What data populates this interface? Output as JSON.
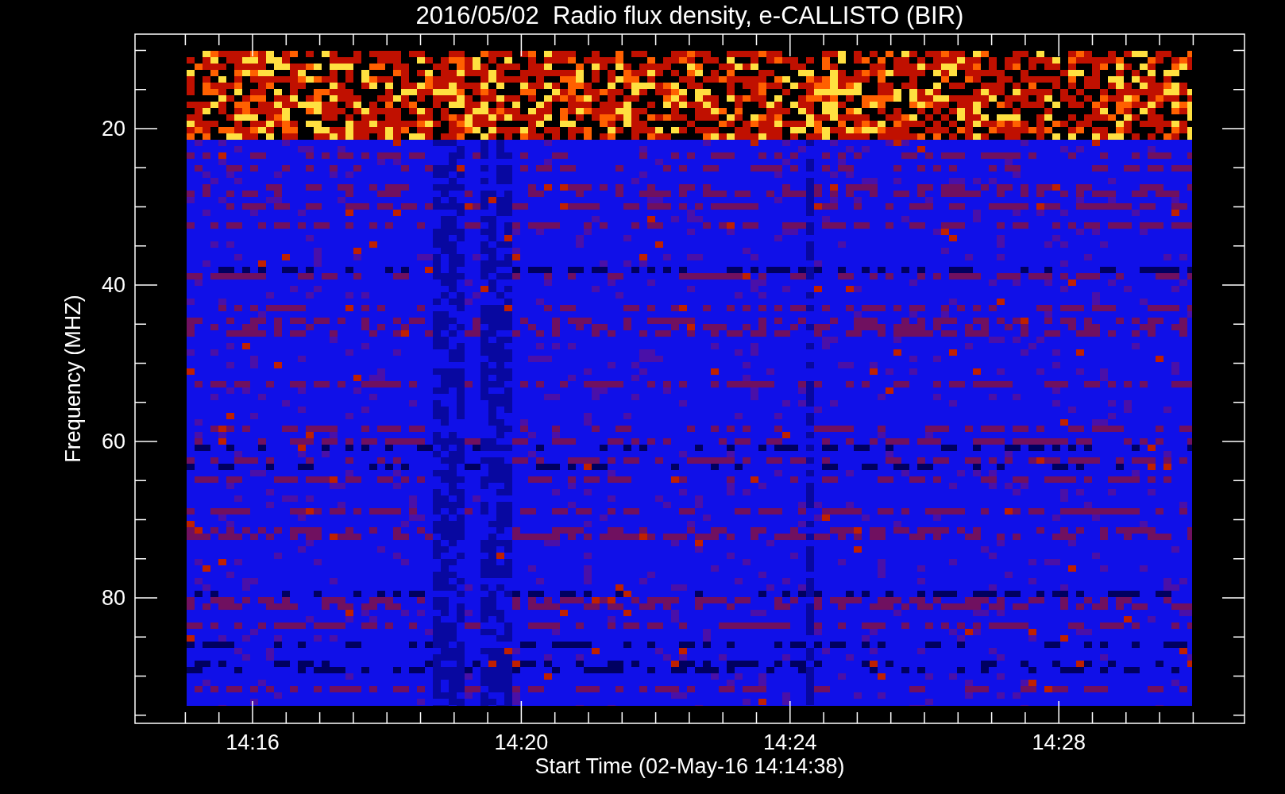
{
  "plot": {
    "title": "2016/05/02  Radio flux density, e-CALLISTO (BIR)",
    "ylabel": "Frequency (MHZ)",
    "xlabel": "Start Time (02-May-16 14:14:38)",
    "yticks": [
      "20",
      "40",
      "60",
      "80"
    ],
    "xticks": [
      "14:16",
      "14:20",
      "14:24",
      "14:28"
    ]
  }
}
